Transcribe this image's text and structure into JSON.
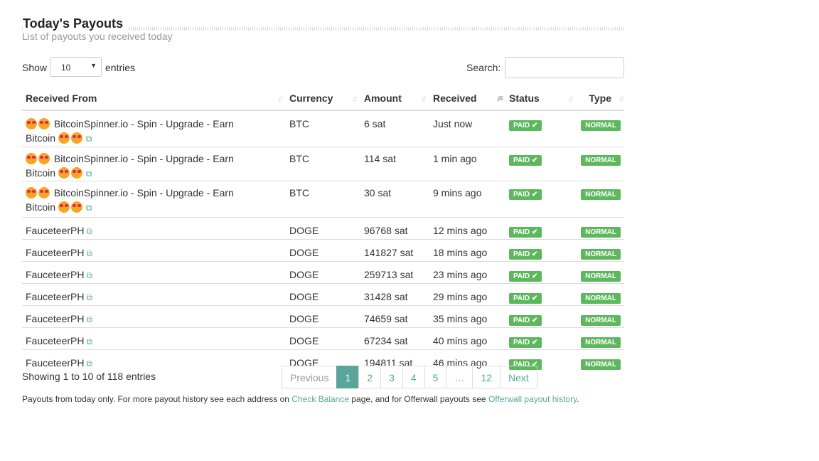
{
  "header": {
    "title": "Today's Payouts",
    "subtitle": "List of payouts you received today"
  },
  "controls": {
    "show_label": "Show",
    "entries_value": "10",
    "entries_label": "entries",
    "search_label": "Search:",
    "search_value": ""
  },
  "table": {
    "columns": [
      "Received From",
      "Currency",
      "Amount",
      "Received",
      "Status",
      "Type"
    ],
    "rows": [
      {
        "from_line1": "BitcoinSpinner.io - Spin - Upgrade - Earn",
        "from_line2": "Bitcoin",
        "emoji": true,
        "currency": "BTC",
        "amount": "6 sat",
        "received": "Just now",
        "status": "PAID",
        "type": "NORMAL"
      },
      {
        "from_line1": "BitcoinSpinner.io - Spin - Upgrade - Earn",
        "from_line2": "Bitcoin",
        "emoji": true,
        "currency": "BTC",
        "amount": "114 sat",
        "received": "1 min ago",
        "status": "PAID",
        "type": "NORMAL"
      },
      {
        "from_line1": "BitcoinSpinner.io - Spin - Upgrade - Earn",
        "from_line2": "Bitcoin",
        "emoji": true,
        "currency": "BTC",
        "amount": "30 sat",
        "received": "9 mins ago",
        "status": "PAID",
        "type": "NORMAL"
      },
      {
        "from_line1": "FauceteerPH",
        "from_line2": "",
        "emoji": false,
        "currency": "DOGE",
        "amount": "96768 sat",
        "received": "12 mins ago",
        "status": "PAID",
        "type": "NORMAL"
      },
      {
        "from_line1": "FauceteerPH",
        "from_line2": "",
        "emoji": false,
        "currency": "DOGE",
        "amount": "141827 sat",
        "received": "18 mins ago",
        "status": "PAID",
        "type": "NORMAL"
      },
      {
        "from_line1": "FauceteerPH",
        "from_line2": "",
        "emoji": false,
        "currency": "DOGE",
        "amount": "259713 sat",
        "received": "23 mins ago",
        "status": "PAID",
        "type": "NORMAL"
      },
      {
        "from_line1": "FauceteerPH",
        "from_line2": "",
        "emoji": false,
        "currency": "DOGE",
        "amount": "31428 sat",
        "received": "29 mins ago",
        "status": "PAID",
        "type": "NORMAL"
      },
      {
        "from_line1": "FauceteerPH",
        "from_line2": "",
        "emoji": false,
        "currency": "DOGE",
        "amount": "74659 sat",
        "received": "35 mins ago",
        "status": "PAID",
        "type": "NORMAL"
      },
      {
        "from_line1": "FauceteerPH",
        "from_line2": "",
        "emoji": false,
        "currency": "DOGE",
        "amount": "67234 sat",
        "received": "40 mins ago",
        "status": "PAID",
        "type": "NORMAL"
      },
      {
        "from_line1": "FauceteerPH",
        "from_line2": "",
        "emoji": false,
        "currency": "DOGE",
        "amount": "194811 sat",
        "received": "46 mins ago",
        "status": "PAID",
        "type": "NORMAL"
      }
    ]
  },
  "footer": {
    "info": "Showing 1 to 10 of 118 entries",
    "pager": [
      "Previous",
      "1",
      "2",
      "3",
      "4",
      "5",
      "…",
      "12",
      "Next"
    ],
    "note_pre": "Payouts from today only. For more payout history see each address on ",
    "note_link1": "Check Balance",
    "note_mid": " page, and for Offerwall payouts see ",
    "note_link2": "Offerwall payout history",
    "note_post": "."
  },
  "colors": {
    "accent": "#5aa59a",
    "badge": "#5cb85c"
  }
}
